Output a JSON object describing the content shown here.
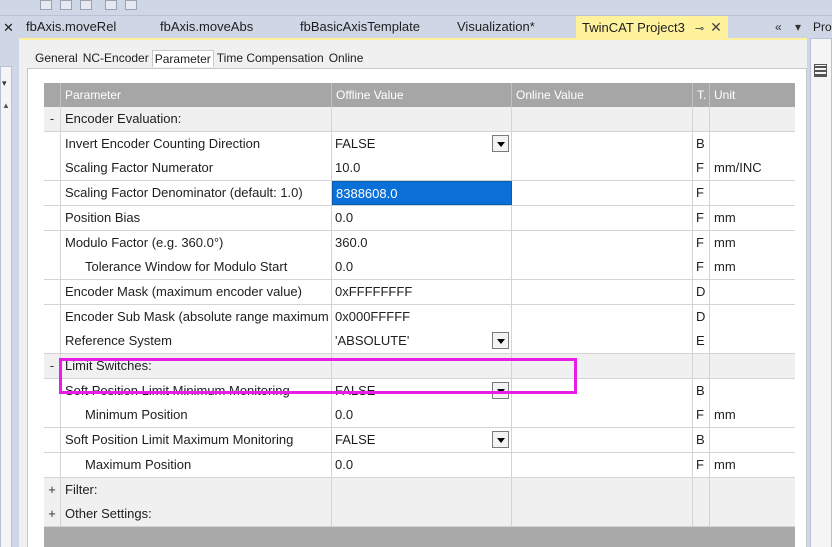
{
  "tabs": [
    {
      "label": "fbAxis.moveRel",
      "active": false
    },
    {
      "label": "fbAxis.moveAbs",
      "active": false
    },
    {
      "label": "fbBasicAxisTemplate",
      "active": false
    },
    {
      "label": "Visualization*",
      "active": false
    },
    {
      "label": "TwinCAT Project3",
      "active": true
    }
  ],
  "tab_controls": {
    "overflow": "«",
    "menu": "▾"
  },
  "right_panel": {
    "title": "Pro"
  },
  "property_tabs": [
    "General",
    "NC-Encoder",
    "Parameter",
    "Time Compensation",
    "Online"
  ],
  "active_property_tab": "Parameter",
  "grid": {
    "columns": [
      "Parameter",
      "Offline Value",
      "Online Value",
      "T.",
      "Unit"
    ],
    "rows": [
      {
        "expander": "-",
        "param": "Encoder Evaluation:",
        "offline": "",
        "type": "",
        "unit": "",
        "group": true
      },
      {
        "expander": "",
        "param": "Invert Encoder Counting Direction",
        "offline": "FALSE",
        "type": "B",
        "unit": "",
        "dropdown": true
      },
      {
        "expander": "",
        "param": "Scaling Factor Numerator",
        "offline": "10.0",
        "type": "F",
        "unit": "mm/INC"
      },
      {
        "expander": "",
        "param": "Scaling Factor Denominator (default: 1.0)",
        "offline": "8388608.0",
        "type": "F",
        "unit": "",
        "selected": true
      },
      {
        "expander": "",
        "param": "Position Bias",
        "offline": "0.0",
        "type": "F",
        "unit": "mm"
      },
      {
        "expander": "",
        "param": "Modulo Factor (e.g. 360.0°)",
        "offline": "360.0",
        "type": "F",
        "unit": "mm"
      },
      {
        "expander": "",
        "param": "Tolerance Window for Modulo Start",
        "offline": "0.0",
        "type": "F",
        "unit": "mm",
        "indent": true
      },
      {
        "expander": "",
        "param": "Encoder Mask (maximum encoder value)",
        "offline": "0xFFFFFFFF",
        "type": "D",
        "unit": ""
      },
      {
        "expander": "",
        "param": "Encoder Sub Mask (absolute range maximum va",
        "offline": "0x000FFFFF",
        "type": "D",
        "unit": ""
      },
      {
        "expander": "",
        "param": "Reference System",
        "offline": "'ABSOLUTE'",
        "type": "E",
        "unit": "",
        "dropdown": true
      },
      {
        "expander": "-",
        "param": "Limit Switches:",
        "offline": "",
        "type": "",
        "unit": "",
        "group": true
      },
      {
        "expander": "",
        "param": "Soft Position Limit Minimum Monitoring",
        "offline": "FALSE",
        "type": "B",
        "unit": "",
        "dropdown": true
      },
      {
        "expander": "",
        "param": "Minimum Position",
        "offline": "0.0",
        "type": "F",
        "unit": "mm",
        "indent": true
      },
      {
        "expander": "",
        "param": "Soft Position Limit Maximum Monitoring",
        "offline": "FALSE",
        "type": "B",
        "unit": "",
        "dropdown": true
      },
      {
        "expander": "",
        "param": "Maximum Position",
        "offline": "0.0",
        "type": "F",
        "unit": "mm",
        "indent": true
      },
      {
        "expander": "+",
        "param": "Filter:",
        "offline": "",
        "type": "",
        "unit": "",
        "group": true
      },
      {
        "expander": "+",
        "param": "Other Settings:",
        "offline": "",
        "type": "",
        "unit": "",
        "group": true
      }
    ]
  },
  "colors": {
    "highlight": "#e81ee8",
    "active_tab": "#fff29d",
    "selection": "#0a6fd6"
  }
}
